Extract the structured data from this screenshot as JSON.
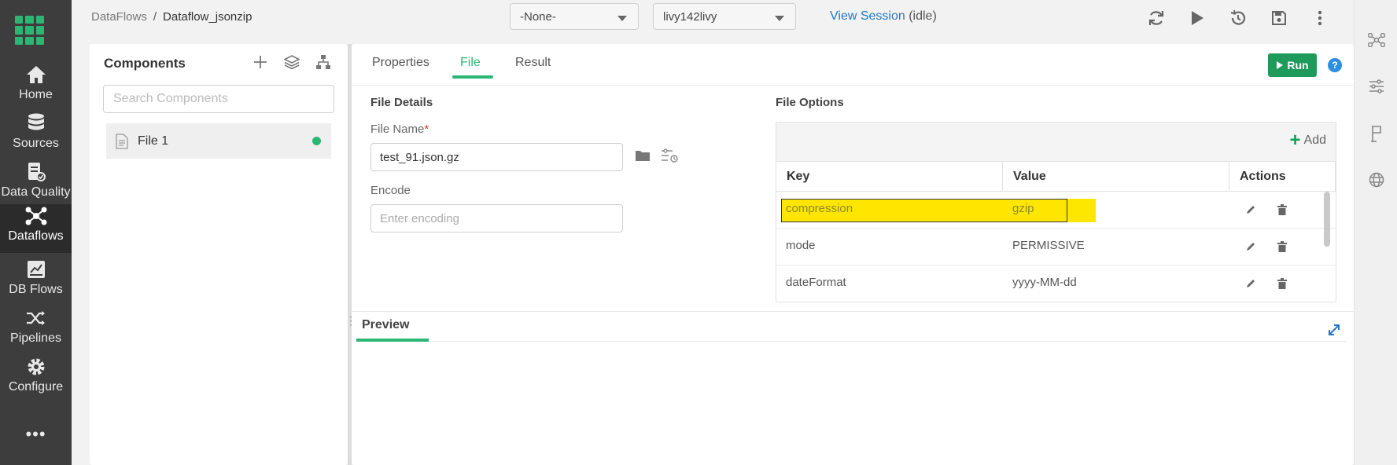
{
  "nav": {
    "items": [
      {
        "label": "Home",
        "icon": "home-icon"
      },
      {
        "label": "Sources",
        "icon": "database-icon"
      },
      {
        "label": "Data Quality",
        "icon": "data-quality-icon"
      },
      {
        "label": "Dataflows",
        "icon": "dataflows-icon"
      },
      {
        "label": "DB Flows",
        "icon": "db-flows-icon"
      },
      {
        "label": "Pipelines",
        "icon": "pipelines-icon"
      },
      {
        "label": "Configure",
        "icon": "gear-icon"
      }
    ],
    "more": "•••",
    "active": "Dataflows"
  },
  "breadcrumb": {
    "root": "DataFlows",
    "sep": "/",
    "current": "Dataflow_jsonzip"
  },
  "selects": {
    "first": "-None-",
    "second": "livy142livy"
  },
  "session": {
    "link": "View Session",
    "state": "(idle)"
  },
  "components": {
    "title": "Components",
    "search_placeholder": "Search Components",
    "items": [
      {
        "label": "File 1",
        "status_color": "#2bb673"
      }
    ]
  },
  "tabs": {
    "properties": "Properties",
    "file": "File",
    "result": "Result",
    "active": "File"
  },
  "run": {
    "label": "Run",
    "help": "?"
  },
  "file_details": {
    "title": "File Details",
    "file_name_label": "File Name",
    "file_name_required": "*",
    "file_name_value": "test_91.json.gz",
    "encode_label": "Encode",
    "encode_placeholder": "Enter encoding"
  },
  "file_options": {
    "title": "File Options",
    "add_label": "Add",
    "columns": {
      "key": "Key",
      "value": "Value",
      "actions": "Actions"
    },
    "rows": [
      {
        "key": "compression",
        "value": "gzip",
        "highlighted": true
      },
      {
        "key": "mode",
        "value": "PERMISSIVE",
        "highlighted": false
      },
      {
        "key": "dateFormat",
        "value": "yyyy-MM-dd",
        "highlighted": false
      }
    ]
  },
  "preview": {
    "title": "Preview"
  },
  "colors": {
    "accent": "#2bb673",
    "run": "#1e9b5b",
    "link": "#1f78c8",
    "highlight": "#ffe600",
    "nav_bg": "#3d3d3d"
  }
}
